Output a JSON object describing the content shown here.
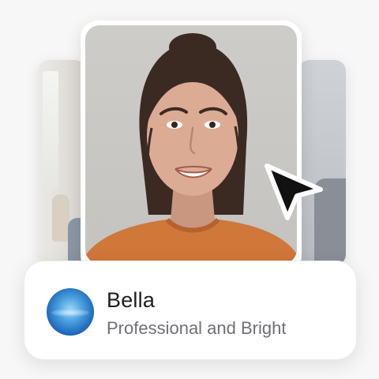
{
  "voice_card": {
    "name": "Bella",
    "description": "Professional and Bright",
    "avatar_icon": "blue-orb-icon"
  },
  "cursor_icon": "pointer-arrow-icon",
  "colors": {
    "background": "#f7f7f8",
    "card": "#ffffff",
    "name_text": "#1d1d22",
    "description_text": "#6f7076",
    "sweater": "#d0773a",
    "avatar_blue": "#1d67b8"
  }
}
